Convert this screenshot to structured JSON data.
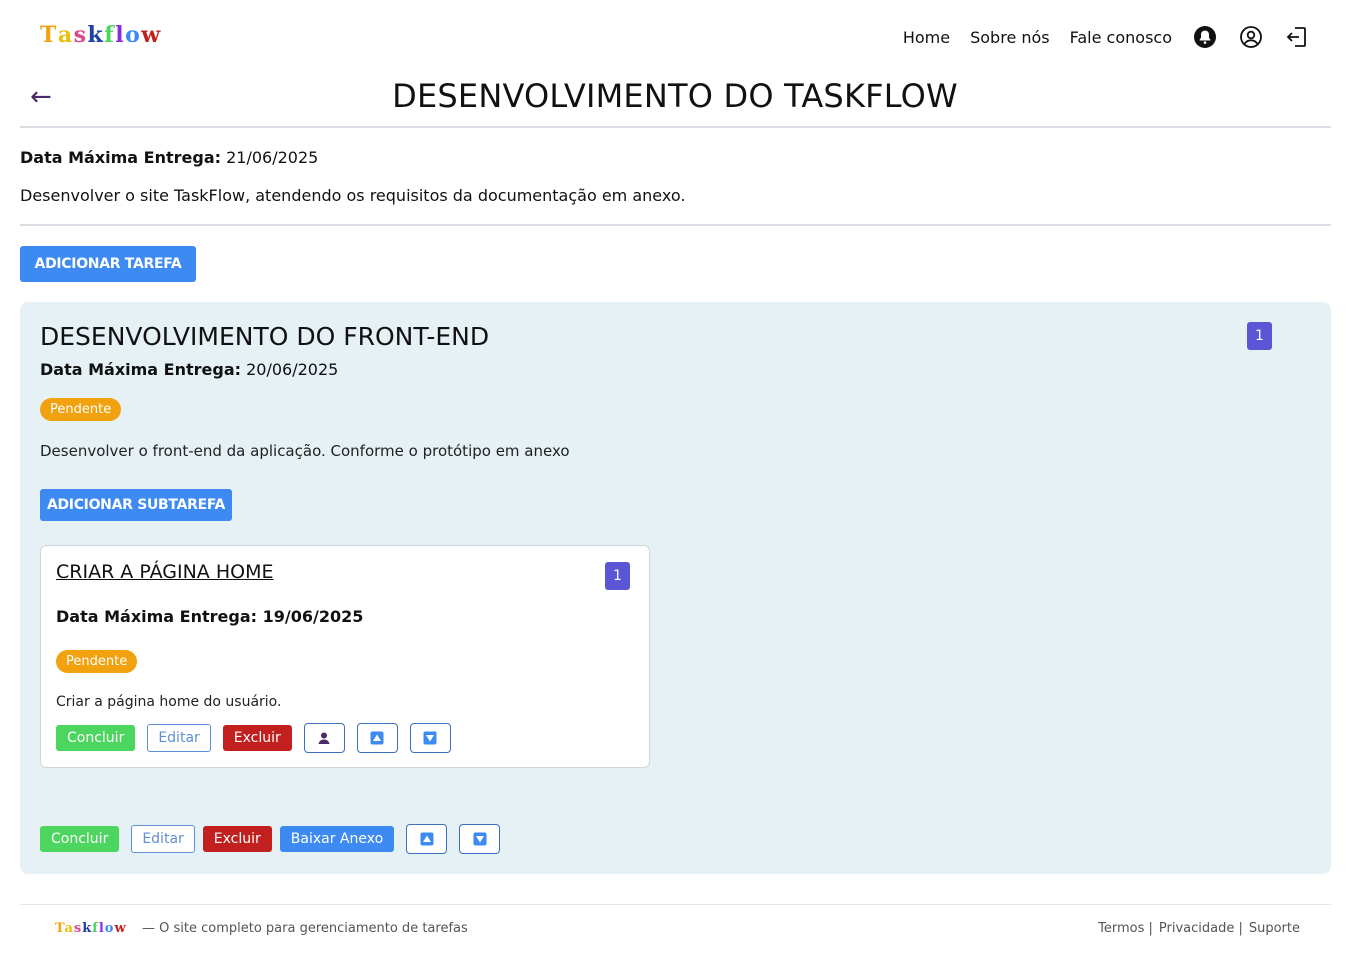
{
  "header": {
    "logo": "Taskflow",
    "logo_colors": [
      "#f3a20f",
      "#e5c10a",
      "#d94a8a",
      "#1f3fa8",
      "#4dd65f",
      "#8a2be2",
      "#3d8bf2",
      "#c21f1f"
    ],
    "nav": [
      "Home",
      "Sobre nós",
      "Fale conosco"
    ],
    "icons": [
      "bell-icon",
      "user-circle-icon",
      "logout-icon"
    ]
  },
  "page": {
    "back_icon": "←",
    "title": "DESENVOLVIMENTO DO TASKFLOW",
    "deadline_label": "Data Máxima Entrega:",
    "deadline_value": "21/06/2025",
    "description": "Desenvolver o site TaskFlow, atendendo os requisitos da documentação em anexo.",
    "add_task_label": "ADICIONAR TAREFA"
  },
  "task": {
    "title": "DESENVOLVIMENTO DO FRONT-END",
    "count": "1",
    "deadline_label": "Data Máxima Entrega:",
    "deadline_value": "20/06/2025",
    "status": "Pendente",
    "description": "Desenvolver o front-end da aplicação. Conforme o protótipo em anexo",
    "add_subtask_label": "ADICIONAR SUBTAREFA",
    "actions": {
      "complete": "Concluir",
      "edit": "Editar",
      "delete": "Excluir",
      "download": "Baixar Anexo"
    }
  },
  "subtask": {
    "title": "CRIAR A PÁGINA HOME",
    "count": "1",
    "deadline_label": "Data Máxima Entrega:",
    "deadline_value": "19/06/2025",
    "status": "Pendente",
    "description": "Criar a página home do usuário.",
    "actions": {
      "complete": "Concluir",
      "edit": "Editar",
      "delete": "Excluir"
    }
  },
  "footer": {
    "logo": "Taskflow",
    "tagline": "— O site completo para gerenciamento de tarefas",
    "links": [
      "Termos |",
      "Privacidade |",
      "Suporte"
    ]
  },
  "colors": {
    "primary": "#3d8bf2",
    "success": "#4dd65f",
    "danger": "#c21f1f",
    "warning": "#f3a20f",
    "badge": "#5a56d6",
    "panel": "#e6f1f6"
  }
}
